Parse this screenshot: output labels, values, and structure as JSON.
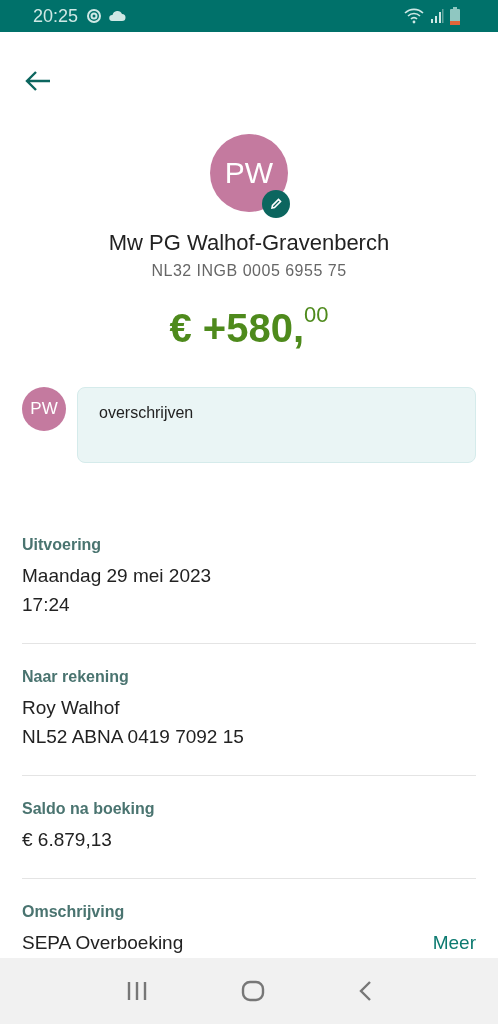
{
  "status_bar": {
    "time": "20:25"
  },
  "contact": {
    "initials": "PW",
    "name": "Mw PG Walhof-Gravenberch",
    "iban": "NL32 INGB 0005 6955 75"
  },
  "amount": {
    "main": "€ +580,",
    "cents": "00"
  },
  "message": {
    "initials": "PW",
    "text": "overschrijven"
  },
  "details": [
    {
      "label": "Uitvoering",
      "lines": [
        "Maandag 29 mei 2023",
        "17:24"
      ]
    },
    {
      "label": "Naar rekening",
      "lines": [
        "Roy Walhof",
        "NL52 ABNA 0419 7092 15"
      ]
    },
    {
      "label": "Saldo na boeking",
      "lines": [
        "€ 6.879,13"
      ]
    },
    {
      "label": "Omschrijving",
      "lines": [
        "SEPA Overboeking"
      ],
      "link": "Meer"
    }
  ]
}
